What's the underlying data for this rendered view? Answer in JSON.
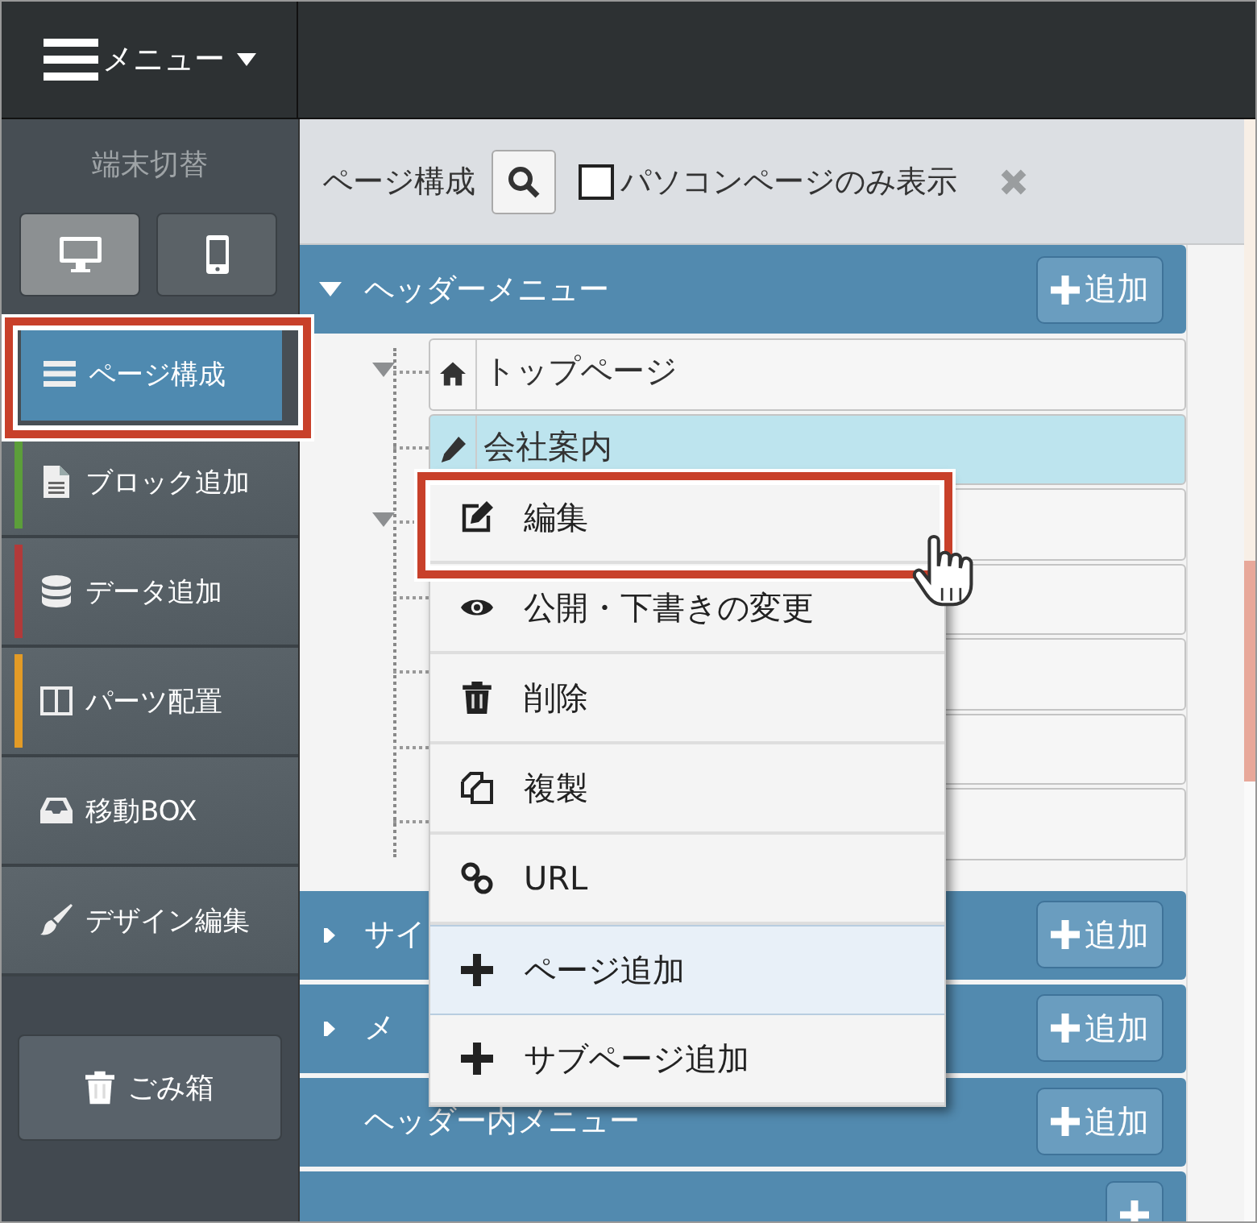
{
  "menu_button": {
    "label": "メニュー"
  },
  "sidebar": {
    "device_label": "端末切替",
    "devices": [
      {
        "kind": "desktop",
        "selected": true
      },
      {
        "kind": "phone",
        "selected": false
      }
    ],
    "items": [
      {
        "label": "ページ構成",
        "kind": "list",
        "selected": true
      },
      {
        "label": "ブロック追加",
        "kind": "file",
        "selected": false,
        "color": "#5c9e3a"
      },
      {
        "label": "データ追加",
        "kind": "database",
        "selected": false,
        "color": "#b23a3a"
      },
      {
        "label": "パーツ配置",
        "kind": "columns",
        "selected": false,
        "color": "#e39b26"
      },
      {
        "label": "移動BOX",
        "kind": "inbox",
        "selected": false
      },
      {
        "label": "デザイン編集",
        "kind": "brush",
        "selected": false
      }
    ],
    "trash_button": {
      "label": "ごみ箱"
    }
  },
  "panel": {
    "title": "ページ構成",
    "filter": {
      "label": "パソコンページのみ表示",
      "checked": false
    },
    "sections": [
      {
        "title": "ヘッダーメニュー",
        "expanded": true,
        "add_label": "追加",
        "pages": [
          {
            "label": "トップページ",
            "kind": "home",
            "expanded": true,
            "selected": false
          },
          {
            "label": "会社案内",
            "kind": "pencil",
            "expanded": false,
            "selected": true
          },
          {
            "expanded": true,
            "selected": false
          },
          {
            "expanded": false,
            "selected": false
          },
          {
            "expanded": false,
            "selected": false
          },
          {
            "expanded": false,
            "selected": false
          },
          {
            "expanded": false,
            "selected": false
          }
        ]
      },
      {
        "title": "サイ",
        "expanded": false,
        "add_label": "追加"
      },
      {
        "title": "メ",
        "expanded": false,
        "add_label": "追加"
      },
      {
        "title": "ヘッダー内メニュー",
        "add_label": "追加"
      }
    ]
  },
  "context_menu": {
    "items": [
      {
        "label": "編集",
        "kind": "edit",
        "selected": false
      },
      {
        "label": "公開・下書きの変更",
        "kind": "eye",
        "selected": false
      },
      {
        "label": "削除",
        "kind": "trash",
        "selected": false
      },
      {
        "label": "複製",
        "kind": "copy",
        "selected": false
      },
      {
        "label": "URL",
        "kind": "link",
        "selected": false
      },
      {
        "label": "ページ追加",
        "kind": "plus",
        "selected": true
      },
      {
        "label": "サブページ追加",
        "kind": "plus",
        "selected": false
      }
    ]
  }
}
